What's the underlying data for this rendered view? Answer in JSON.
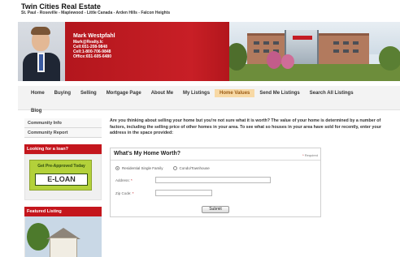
{
  "header": {
    "site_title": "Twin Cities Real Estate",
    "site_subtitle": "St. Paul - Roseville - Maplewood - Little Canada - Arden Hills - Falcon Heights"
  },
  "agent": {
    "name": "Mark Westpfahl",
    "email": "Mark@Realty.lc",
    "cell": "Cell:651-208-9848",
    "toll_free": "Cell:1-800-706-9848",
    "office": "Office:651-605-6480"
  },
  "nav": {
    "items": [
      "Home",
      "Buying",
      "Selling",
      "Mortgage Page",
      "About Me",
      "My Listings",
      "Home Values",
      "Send Me Listings",
      "Search All Listings"
    ],
    "active": "Home Values",
    "second_row": "Blog"
  },
  "sidebar": {
    "links": [
      "Community Info",
      "Community Report"
    ],
    "loan_heading": "Looking for a loan?",
    "eloan_pre": "Get Pre-Approved Today",
    "eloan_logo": "E-LOAN",
    "featured_heading": "Featured Listing"
  },
  "main": {
    "intro": "Are you thinking about selling your home but you're not sure what it is worth? The value of your home is determined by a number of factors, including the selling price of other homes in your area. To see what so houses in your area have sold for recently, enter your address in the space provided:",
    "form": {
      "title": "What's My Home Worth?",
      "required_note": "Required",
      "property_types": [
        "Residential Single Family",
        "Condo/Townhouse"
      ],
      "selected_type": "Residential Single Family",
      "address_label": "Address:",
      "address_value": "",
      "zip_label": "Zip Code:",
      "zip_value": "",
      "submit_label": "Submit"
    }
  },
  "colors": {
    "brand_red": "#c41b22",
    "active_tab_bg": "#f8d9a5",
    "eloan_green": "#b3d13a"
  }
}
